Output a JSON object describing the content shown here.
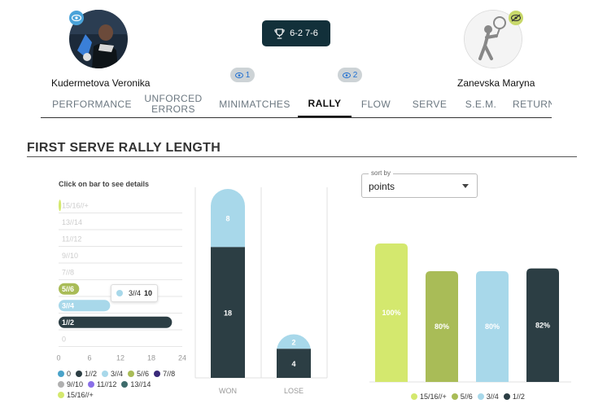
{
  "players": {
    "left": {
      "name": "Kudermetova Veronika"
    },
    "right": {
      "name": "Zanevska Maryna"
    }
  },
  "score": "6-2 7-6",
  "views": {
    "left": "1",
    "right": "2"
  },
  "tabs": [
    {
      "label": "PERFORMANCE",
      "active": false
    },
    {
      "label": "UNFORCED ERRORS",
      "active": false
    },
    {
      "label": "MINIMATCHES",
      "active": false
    },
    {
      "label": "RALLY",
      "active": true
    },
    {
      "label": "FLOW",
      "active": false
    },
    {
      "label": "SERVE",
      "active": false
    },
    {
      "label": "S.E.M.",
      "active": false
    },
    {
      "label": "RETURN",
      "active": false
    }
  ],
  "section_title": "FIRST SERVE RALLY LENGTH",
  "hint": "Click on bar to see details",
  "sort": {
    "label": "sort by",
    "value": "points"
  },
  "colors": {
    "c15": "#d4e86e",
    "c13": "#3d6b6b",
    "c11": "#8a6fe8",
    "c9": "#b0b0b0",
    "c7": "#3a2a7a",
    "c5": "#a9bc57",
    "c3": "#a8d8ea",
    "c1": "#2c3e44",
    "c0": "#4aa3c9"
  },
  "chart_data": [
    {
      "type": "bar",
      "orientation": "horizontal",
      "categories": [
        "15/16//+",
        "13//14",
        "11//12",
        "9//10",
        "7//8",
        "5//6",
        "3//4",
        "1//2",
        "0"
      ],
      "values": [
        0.5,
        0,
        0,
        0,
        0,
        4,
        10,
        22,
        0
      ],
      "xlim": [
        0,
        24
      ],
      "xticks": [
        "0",
        "6",
        "12",
        "18",
        "24"
      ],
      "tooltip": {
        "label": "3//4",
        "value": "10"
      },
      "legend": [
        "0",
        "1//2",
        "3//4",
        "5//6",
        "7//8",
        "9//10",
        "11//12",
        "13//14",
        "15/16//+"
      ]
    },
    {
      "type": "bar",
      "stacked": true,
      "categories": [
        "WON",
        "LOSE"
      ],
      "series": [
        {
          "values": [
            18,
            4
          ]
        },
        {
          "values": [
            8,
            2
          ]
        }
      ],
      "labels": {
        "won_bottom": "18",
        "won_top": "8",
        "lose_bottom": "4",
        "lose_top": "2"
      }
    },
    {
      "type": "bar",
      "categories": [
        "15/16//+",
        "5//6",
        "3//4",
        "1//2"
      ],
      "values": [
        100,
        80,
        80,
        82
      ],
      "labels": [
        "100%",
        "80%",
        "80%",
        "82%"
      ],
      "legend": [
        "15/16//+",
        "5//6",
        "3//4",
        "1//2"
      ]
    }
  ]
}
